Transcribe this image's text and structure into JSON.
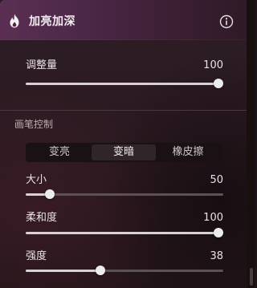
{
  "header": {
    "title": "加亮加深",
    "icon": "flame-icon",
    "info_icon": "info-icon"
  },
  "adjustment": {
    "label": "调整量",
    "value": "100",
    "fraction": 1.0
  },
  "brush_section": {
    "title": "画笔控制",
    "tabs": [
      {
        "label": "变亮",
        "active": false
      },
      {
        "label": "变暗",
        "active": true
      },
      {
        "label": "橡皮擦",
        "active": false
      }
    ]
  },
  "size": {
    "label": "大小",
    "value": "50",
    "fraction": 0.12
  },
  "softness": {
    "label": "柔和度",
    "value": "100",
    "fraction": 1.0
  },
  "strength": {
    "label": "强度",
    "value": "38",
    "fraction": 0.38
  },
  "colors": {
    "accent_header": "#5a2f53",
    "track": "#5c5156",
    "fill": "#d8d2d5",
    "thumb": "#ececec"
  }
}
